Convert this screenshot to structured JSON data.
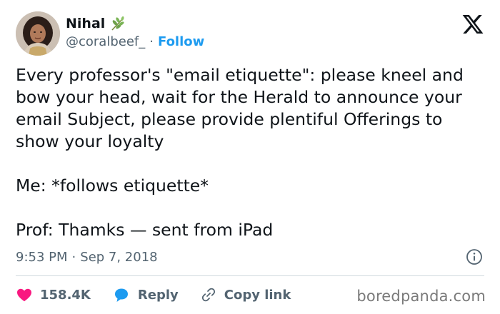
{
  "author": {
    "name": "Nihal",
    "handle": "@coralbeef_",
    "separator": "·",
    "follow_label": "Follow",
    "name_emoji_icon": "herb-leaf-icon"
  },
  "platform": {
    "logo_icon": "x-logo-icon"
  },
  "tweet": {
    "text": "Every professor's \"email etiquette\": please kneel and bow your head, wait for the Herald to announce your email Subject, please provide plentiful Offerings to show your loyalty\n\nMe: *follows etiquette*\n\nProf: Thamks — sent from iPad",
    "time": "9:53 PM",
    "separator": "·",
    "date": "Sep 7, 2018"
  },
  "actions": {
    "like_count": "158.4K",
    "reply_label": "Reply",
    "copy_link_label": "Copy link"
  },
  "colors": {
    "accent": "#1d9bf0",
    "like": "#f91880",
    "text": "#0f1419",
    "muted": "#536471",
    "divider": "#cfd9de"
  },
  "watermark": "boredpanda.com"
}
